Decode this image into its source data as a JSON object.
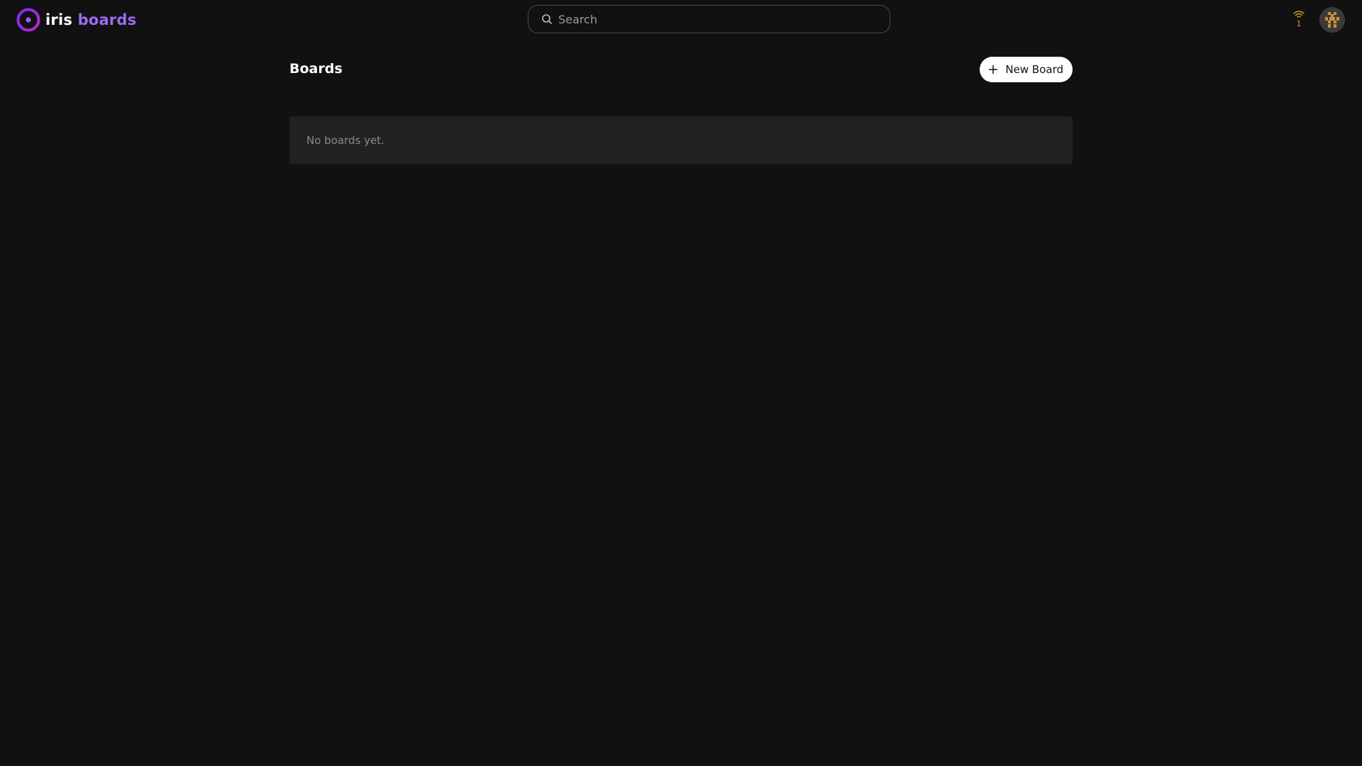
{
  "app": {
    "logo_word1": "iris",
    "logo_word2": "boards",
    "logo_icon": "iris-logo-icon",
    "brand_color": "#9b6cf0"
  },
  "header": {
    "search_placeholder": "Search",
    "search_value": "",
    "search_icon": "search-icon",
    "relay_icon": "wifi-icon",
    "relay_count": "1",
    "relay_color": "#d99a2b",
    "avatar_icon": "identicon-avatar"
  },
  "main": {
    "title": "Boards",
    "new_board_label": "New Board",
    "new_board_icon": "plus-icon",
    "empty_message": "No boards yet."
  }
}
